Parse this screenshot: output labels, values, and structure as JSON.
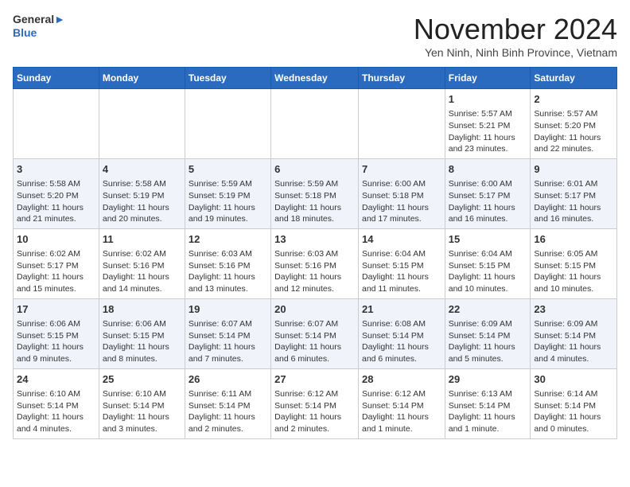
{
  "header": {
    "logo_line1": "General",
    "logo_line2": "Blue",
    "month_title": "November 2024",
    "location": "Yen Ninh, Ninh Binh Province, Vietnam"
  },
  "weekdays": [
    "Sunday",
    "Monday",
    "Tuesday",
    "Wednesday",
    "Thursday",
    "Friday",
    "Saturday"
  ],
  "weeks": [
    [
      {
        "day": "",
        "info": ""
      },
      {
        "day": "",
        "info": ""
      },
      {
        "day": "",
        "info": ""
      },
      {
        "day": "",
        "info": ""
      },
      {
        "day": "",
        "info": ""
      },
      {
        "day": "1",
        "info": "Sunrise: 5:57 AM\nSunset: 5:21 PM\nDaylight: 11 hours and 23 minutes."
      },
      {
        "day": "2",
        "info": "Sunrise: 5:57 AM\nSunset: 5:20 PM\nDaylight: 11 hours and 22 minutes."
      }
    ],
    [
      {
        "day": "3",
        "info": "Sunrise: 5:58 AM\nSunset: 5:20 PM\nDaylight: 11 hours and 21 minutes."
      },
      {
        "day": "4",
        "info": "Sunrise: 5:58 AM\nSunset: 5:19 PM\nDaylight: 11 hours and 20 minutes."
      },
      {
        "day": "5",
        "info": "Sunrise: 5:59 AM\nSunset: 5:19 PM\nDaylight: 11 hours and 19 minutes."
      },
      {
        "day": "6",
        "info": "Sunrise: 5:59 AM\nSunset: 5:18 PM\nDaylight: 11 hours and 18 minutes."
      },
      {
        "day": "7",
        "info": "Sunrise: 6:00 AM\nSunset: 5:18 PM\nDaylight: 11 hours and 17 minutes."
      },
      {
        "day": "8",
        "info": "Sunrise: 6:00 AM\nSunset: 5:17 PM\nDaylight: 11 hours and 16 minutes."
      },
      {
        "day": "9",
        "info": "Sunrise: 6:01 AM\nSunset: 5:17 PM\nDaylight: 11 hours and 16 minutes."
      }
    ],
    [
      {
        "day": "10",
        "info": "Sunrise: 6:02 AM\nSunset: 5:17 PM\nDaylight: 11 hours and 15 minutes."
      },
      {
        "day": "11",
        "info": "Sunrise: 6:02 AM\nSunset: 5:16 PM\nDaylight: 11 hours and 14 minutes."
      },
      {
        "day": "12",
        "info": "Sunrise: 6:03 AM\nSunset: 5:16 PM\nDaylight: 11 hours and 13 minutes."
      },
      {
        "day": "13",
        "info": "Sunrise: 6:03 AM\nSunset: 5:16 PM\nDaylight: 11 hours and 12 minutes."
      },
      {
        "day": "14",
        "info": "Sunrise: 6:04 AM\nSunset: 5:15 PM\nDaylight: 11 hours and 11 minutes."
      },
      {
        "day": "15",
        "info": "Sunrise: 6:04 AM\nSunset: 5:15 PM\nDaylight: 11 hours and 10 minutes."
      },
      {
        "day": "16",
        "info": "Sunrise: 6:05 AM\nSunset: 5:15 PM\nDaylight: 11 hours and 10 minutes."
      }
    ],
    [
      {
        "day": "17",
        "info": "Sunrise: 6:06 AM\nSunset: 5:15 PM\nDaylight: 11 hours and 9 minutes."
      },
      {
        "day": "18",
        "info": "Sunrise: 6:06 AM\nSunset: 5:15 PM\nDaylight: 11 hours and 8 minutes."
      },
      {
        "day": "19",
        "info": "Sunrise: 6:07 AM\nSunset: 5:14 PM\nDaylight: 11 hours and 7 minutes."
      },
      {
        "day": "20",
        "info": "Sunrise: 6:07 AM\nSunset: 5:14 PM\nDaylight: 11 hours and 6 minutes."
      },
      {
        "day": "21",
        "info": "Sunrise: 6:08 AM\nSunset: 5:14 PM\nDaylight: 11 hours and 6 minutes."
      },
      {
        "day": "22",
        "info": "Sunrise: 6:09 AM\nSunset: 5:14 PM\nDaylight: 11 hours and 5 minutes."
      },
      {
        "day": "23",
        "info": "Sunrise: 6:09 AM\nSunset: 5:14 PM\nDaylight: 11 hours and 4 minutes."
      }
    ],
    [
      {
        "day": "24",
        "info": "Sunrise: 6:10 AM\nSunset: 5:14 PM\nDaylight: 11 hours and 4 minutes."
      },
      {
        "day": "25",
        "info": "Sunrise: 6:10 AM\nSunset: 5:14 PM\nDaylight: 11 hours and 3 minutes."
      },
      {
        "day": "26",
        "info": "Sunrise: 6:11 AM\nSunset: 5:14 PM\nDaylight: 11 hours and 2 minutes."
      },
      {
        "day": "27",
        "info": "Sunrise: 6:12 AM\nSunset: 5:14 PM\nDaylight: 11 hours and 2 minutes."
      },
      {
        "day": "28",
        "info": "Sunrise: 6:12 AM\nSunset: 5:14 PM\nDaylight: 11 hours and 1 minute."
      },
      {
        "day": "29",
        "info": "Sunrise: 6:13 AM\nSunset: 5:14 PM\nDaylight: 11 hours and 1 minute."
      },
      {
        "day": "30",
        "info": "Sunrise: 6:14 AM\nSunset: 5:14 PM\nDaylight: 11 hours and 0 minutes."
      }
    ]
  ]
}
